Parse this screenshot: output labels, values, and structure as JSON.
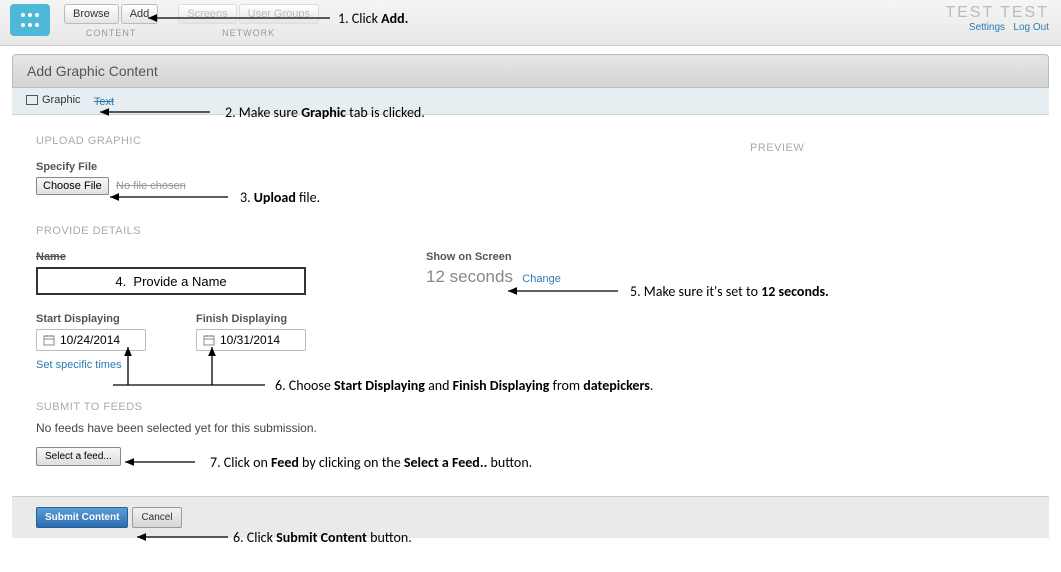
{
  "header": {
    "nav_content": {
      "browse": "Browse",
      "add": "Add",
      "label": "CONTENT"
    },
    "nav_network": {
      "screens": "Screens",
      "usergroups": "User Groups",
      "label": "NETWORK"
    },
    "user": {
      "name": "TEST TEST",
      "settings": "Settings",
      "logout": "Log Out"
    }
  },
  "page": {
    "title": "Add Graphic Content",
    "tabs": {
      "graphic": "Graphic",
      "text": "Text"
    },
    "upload": {
      "heading": "UPLOAD GRAPHIC",
      "specify": "Specify File",
      "choose": "Choose File",
      "status": "No file chosen"
    },
    "preview": "PREVIEW",
    "details": {
      "heading": "PROVIDE DETAILS",
      "name_label": "Name",
      "name_value": "4.  Provide a Name",
      "show_label": "Show on Screen",
      "duration": "12 seconds",
      "change": "Change",
      "start_label": "Start Displaying",
      "start_date": "10/24/2014",
      "finish_label": "Finish Displaying",
      "finish_date": "10/31/2014",
      "set_times": "Set specific times"
    },
    "feeds": {
      "heading": "SUBMIT TO FEEDS",
      "msg": "No feeds have been selected yet for this submission.",
      "select": "Select a feed..."
    },
    "actions": {
      "submit": "Submit Content",
      "cancel": "Cancel"
    }
  },
  "annotations": {
    "a1": "1. Click <b>Add.</b>",
    "a2": "2.      Make sure <b>Graphic</b> tab is clicked.",
    "a3": "3.      <b>Upload</b> file.",
    "a5": "5.      Make sure it's set to <b>12 seconds.</b>",
    "a6": "6.      Choose <b>Start Displaying</b> and <b>Finish Displaying</b> from <b>datepickers</b>.",
    "a7": "7.      Click on <b>Feed</b> by clicking on the <b>Select a Feed..</b>  button.",
    "a8": "6.      Click <b>Submit Content</b> button."
  }
}
